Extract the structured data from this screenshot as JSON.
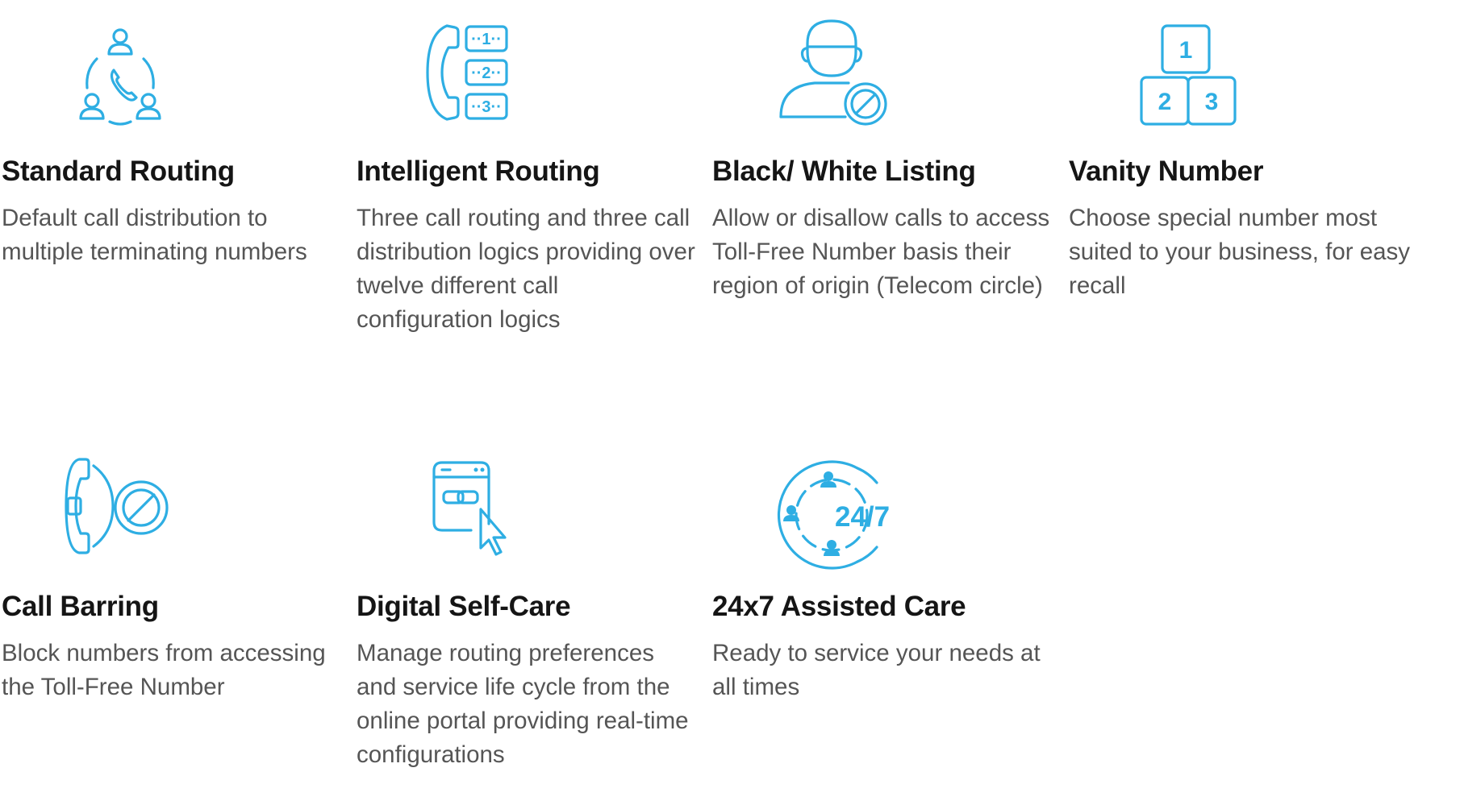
{
  "accent_color": "#2eaee3",
  "features": [
    {
      "title": "Standard Routing",
      "description": "Default call distribution to multiple terminating numbers",
      "icon": "routing-network-icon"
    },
    {
      "title": "Intelligent Routing",
      "description": "Three call routing and three call distribution logics providing over twelve different call configuration logics",
      "icon": "phone-menu-options-icon"
    },
    {
      "title": "Black/ White Listing",
      "description": "Allow or disallow calls to access Toll-Free Number basis their region of origin (Telecom circle)",
      "icon": "user-blocked-icon"
    },
    {
      "title": "Vanity Number",
      "description": "Choose special number most suited to your business, for easy recall",
      "icon": "number-blocks-icon"
    },
    {
      "title": "Call Barring",
      "description": "Block numbers from accessing the Toll-Free Number",
      "icon": "phone-blocked-icon"
    },
    {
      "title": "Digital Self-Care",
      "description": "Manage routing preferences and service life cycle from the online portal providing real-time configurations",
      "icon": "browser-link-cursor-icon"
    },
    {
      "title": "24x7 Assisted Care",
      "description": "Ready to service your needs at all times",
      "icon": "support-24-7-icon",
      "icon_text": "24/7"
    }
  ]
}
